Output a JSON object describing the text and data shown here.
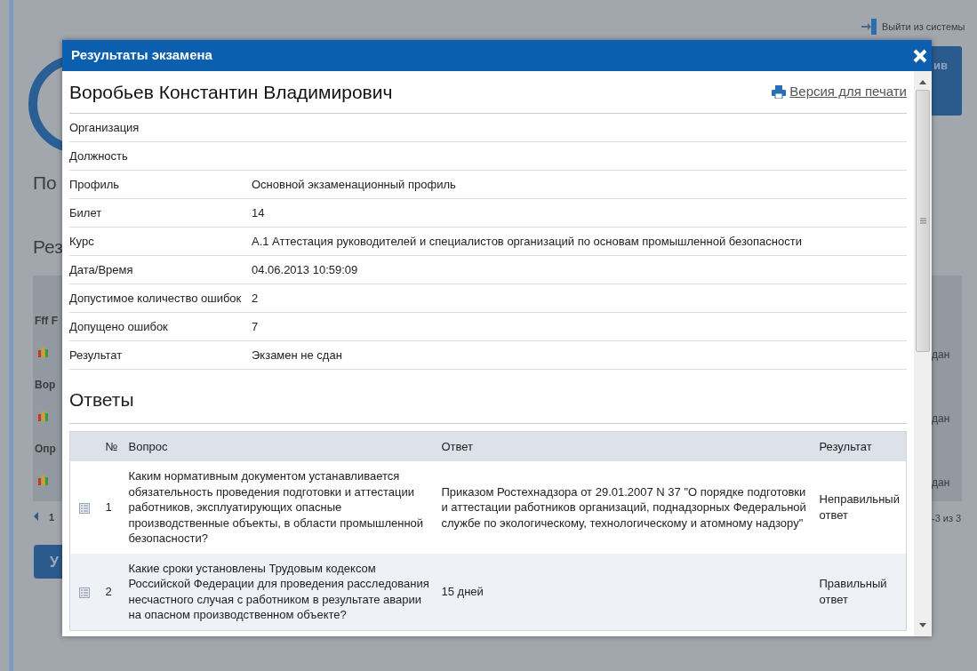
{
  "background": {
    "logout": "Выйти из системы",
    "header_button": "ив",
    "headings": [
      "По",
      "Рез"
    ],
    "list_rows": [
      {
        "name": "Fff F",
        "result": "дан"
      },
      {
        "name": "Вор",
        "result": "дан"
      },
      {
        "name": "Опр",
        "result": "дан"
      }
    ],
    "pager": {
      "page": "1",
      "range": "-3 из 3"
    },
    "button": "У"
  },
  "modal": {
    "title": "Результаты экзамена",
    "person": "Воробьев Константин Владимирович",
    "print_link": "Версия для печати",
    "fields": [
      {
        "label": "Организация"
      },
      {
        "label": "Должность"
      },
      {
        "label": "Профиль",
        "value": "Основной экзаменационный профиль"
      },
      {
        "label": "Билет",
        "value": "14"
      },
      {
        "label": "Курс",
        "value": "А.1 Аттестация руководителей и специалистов организаций по основам промышленной безопасности"
      },
      {
        "label": "Дата/Время",
        "value": "04.06.2013 10:59:09"
      },
      {
        "label": "Допустимое количество ошибок",
        "value": "2"
      },
      {
        "label": "Допущено ошибок",
        "value": "7"
      },
      {
        "label": "Результат",
        "value": "Экзамен не сдан"
      }
    ],
    "answers_heading": "Ответы",
    "table": {
      "columns": [
        "№",
        "Вопрос",
        "Ответ",
        "Результат"
      ],
      "rows": [
        {
          "number": "1",
          "question": "Каким нормативным документом устанавливается обязательность проведения подготовки и аттестации работников, эксплуатирующих опасные производственные объекты, в области промышленной безопасности?",
          "answer": "Приказом Ростехнадзора от 29.01.2007 N 37 \"О порядке подготовки и аттестации работников организаций, поднадзорных Федеральной службе по экологическому, технологическому и атомному надзору\"",
          "result": "Неправильный ответ"
        },
        {
          "number": "2",
          "question": "Какие сроки установлены Трудовым кодексом Российской Федерации для проведения расследования несчастного случая с работником в результате аварии на опасном производственном объекте?",
          "answer": "15 дней",
          "result": "Правильный ответ"
        }
      ]
    }
  }
}
